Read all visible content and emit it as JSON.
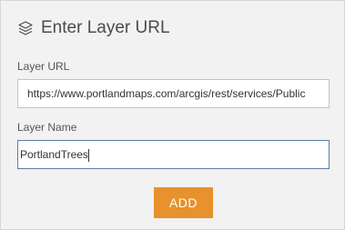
{
  "header": {
    "icon": "layers-icon",
    "title": "Enter Layer URL"
  },
  "form": {
    "url_label": "Layer URL",
    "url_value": "https://www.portlandmaps.com/arcgis/rest/services/Public",
    "name_label": "Layer Name",
    "name_value": "PortlandTrees"
  },
  "actions": {
    "add_label": "ADD",
    "add_color": "#e8912d"
  }
}
